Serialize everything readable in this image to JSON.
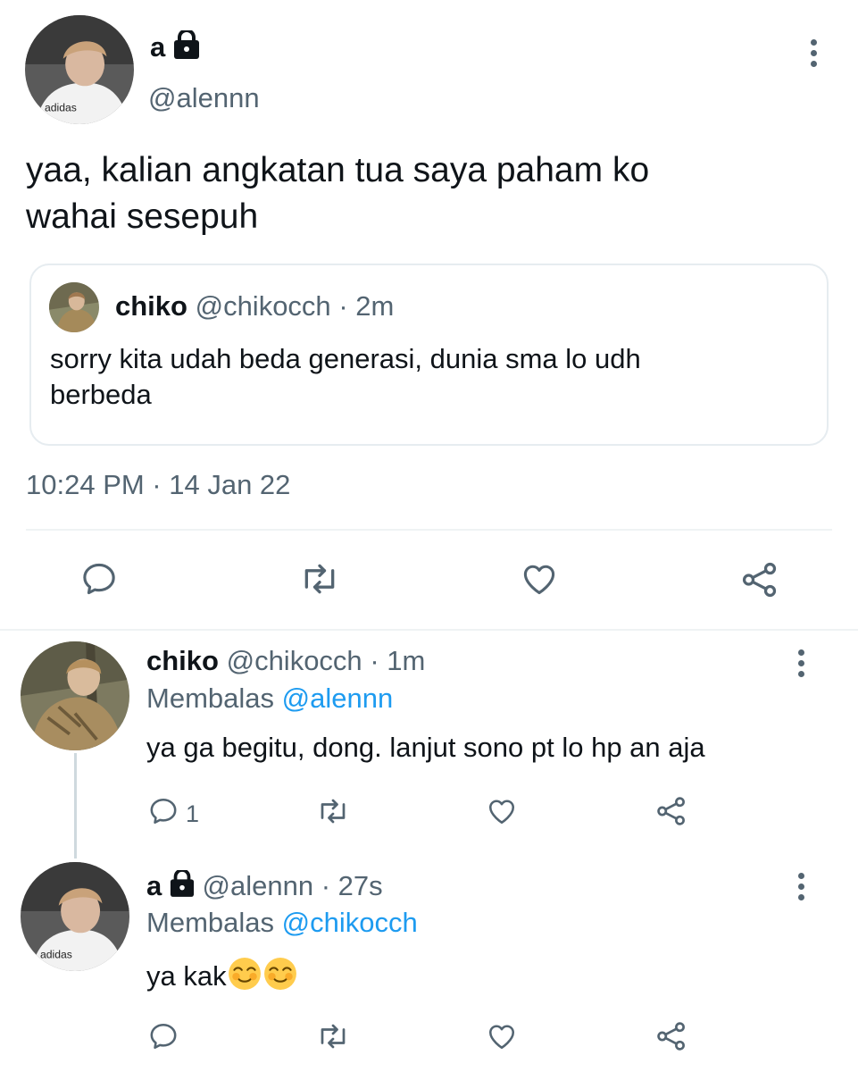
{
  "main_tweet": {
    "display_name": "a",
    "handle": "@alennn",
    "text_line1": "yaa, kalian angkatan tua saya paham ko",
    "text_line2": "wahai sesepuh",
    "timestamp": "10:24 PM · 14 Jan 22"
  },
  "quoted_tweet": {
    "display_name": "chiko",
    "handle": "@chikocch",
    "time": "· 2m",
    "text_line1": "sorry kita udah beda generasi, dunia sma lo udh",
    "text_line2": "berbeda"
  },
  "reply1": {
    "display_name": "chiko",
    "handle": "@chikocch",
    "time": "· 1m",
    "replying_prefix": "Membalas",
    "replying_to": "@alennn",
    "text": "ya ga begitu, dong. lanjut sono pt lo hp an aja",
    "reply_count": "1"
  },
  "reply2": {
    "display_name": "a",
    "handle": "@alennn",
    "time": "· 27s",
    "replying_prefix": "Membalas",
    "replying_to": "@chikocch",
    "text": "ya kak"
  },
  "icons": [
    "lock-icon",
    "more-icon",
    "reply-icon",
    "retweet-icon",
    "like-icon",
    "share-icon",
    "blush-emoji"
  ],
  "colors": {
    "link": "#1d9bf0",
    "muted": "#536471",
    "text": "#0f1419",
    "divider": "#eff3f4"
  }
}
